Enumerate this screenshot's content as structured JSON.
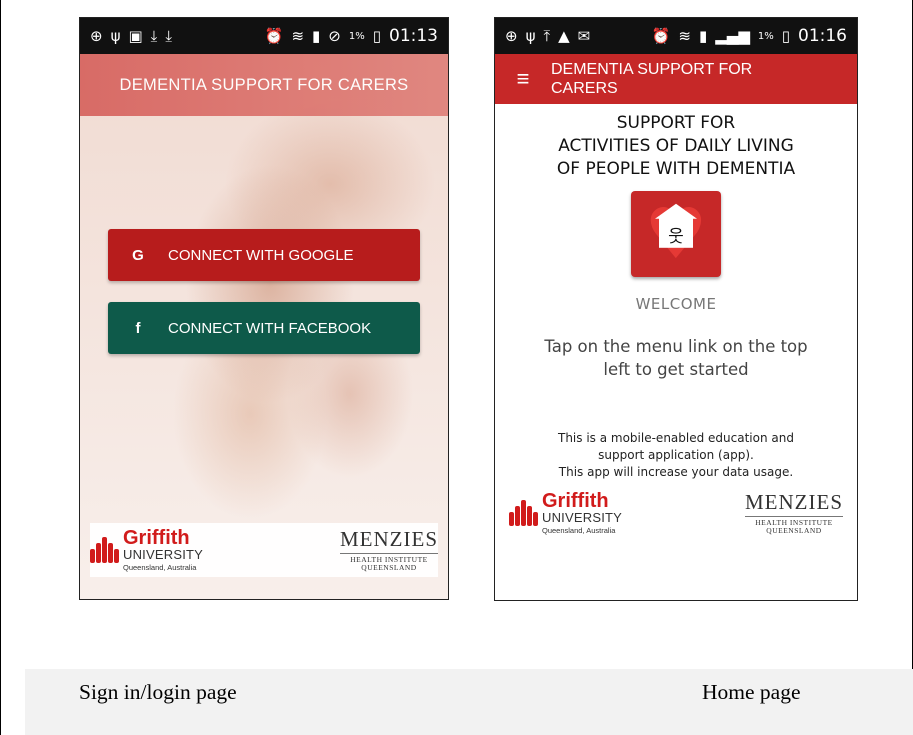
{
  "login": {
    "status_time": "01:13",
    "status_battery": "1%",
    "title": "DEMENTIA SUPPORT FOR CARERS",
    "google_icon": "G",
    "google_label": "CONNECT WITH GOOGLE",
    "facebook_icon": "f",
    "facebook_label": "CONNECT WITH FACEBOOK"
  },
  "home": {
    "status_time": "01:16",
    "status_battery": "1%",
    "menu_icon": "menu-icon",
    "title_line1": "DEMENTIA SUPPORT FOR",
    "title_line2": "CARERS",
    "heading_line1": "SUPPORT FOR",
    "heading_line2": "ACTIVITIES OF DAILY LIVING",
    "heading_line3": "OF PEOPLE WITH DEMENTIA",
    "welcome": "WELCOME",
    "tap_line1": "Tap on the menu link on the top",
    "tap_line2": "left to get started",
    "info_line1": "This is a mobile-enabled education and",
    "info_line2": "support application (app).",
    "info_line3": "This app will increase your data usage."
  },
  "logos": {
    "griffith_name": "Griffith",
    "griffith_university": "UNIVERSITY",
    "griffith_location": "Queensland, Australia",
    "menzies_name": "MENZIES",
    "menzies_sub1": "HEALTH INSTITUTE",
    "menzies_sub2": "QUEENSLAND"
  },
  "captions": {
    "left": "Sign in/login page",
    "right": "Home page"
  },
  "colors": {
    "google_red": "#b71c1c",
    "facebook_green": "#0e5a4a",
    "appbar_red": "#c62828",
    "griffith_red": "#d11b1b"
  }
}
